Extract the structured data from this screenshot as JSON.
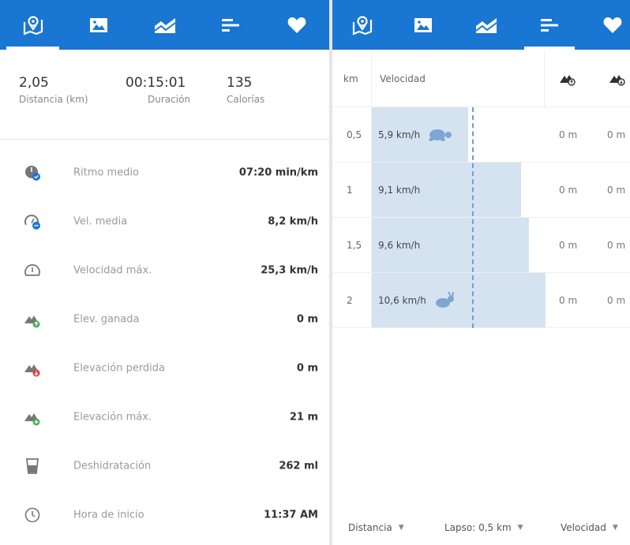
{
  "left": {
    "summary": [
      {
        "value": "2,05",
        "label": "Distancia (km)"
      },
      {
        "value": "00:15:01",
        "label": "Duración"
      },
      {
        "value": "135",
        "label": "Calorías"
      }
    ],
    "stats": [
      {
        "icon": "pace-gauge-icon",
        "label": "Ritmo medio",
        "value": "07:20 min/km"
      },
      {
        "icon": "speedometer-avg-icon",
        "label": "Vel. media",
        "value": "8,2 km/h"
      },
      {
        "icon": "speedometer-max-icon",
        "label": "Velocidad máx.",
        "value": "25,3 km/h"
      },
      {
        "icon": "elevation-gain-icon",
        "label": "Elev. ganada",
        "value": "0 m"
      },
      {
        "icon": "elevation-loss-icon",
        "label": "Elevación perdida",
        "value": "0 m"
      },
      {
        "icon": "elevation-max-icon",
        "label": "Elevación máx.",
        "value": "21 m"
      },
      {
        "icon": "glass-icon",
        "label": "Deshidratación",
        "value": "262 ml"
      },
      {
        "icon": "clock-icon",
        "label": "Hora de inicio",
        "value": "11:37 AM"
      }
    ]
  },
  "tabs": [
    {
      "icon": "map-pin-icon"
    },
    {
      "icon": "image-icon"
    },
    {
      "icon": "chart-icon"
    },
    {
      "icon": "bars-icon"
    },
    {
      "icon": "heart-icon"
    }
  ],
  "right": {
    "headers": {
      "km": "km",
      "speed": "Velocidad"
    },
    "rows": [
      {
        "km": "0,5",
        "speed": "5,9 km/h",
        "speed_kmh": 5.9,
        "marker": "turtle-icon",
        "gain": "0 m",
        "loss": "0 m"
      },
      {
        "km": "1",
        "speed": "9,1 km/h",
        "speed_kmh": 9.1,
        "marker": "",
        "gain": "0 m",
        "loss": "0 m"
      },
      {
        "km": "1,5",
        "speed": "9,6 km/h",
        "speed_kmh": 9.6,
        "marker": "",
        "gain": "0 m",
        "loss": "0 m"
      },
      {
        "km": "2",
        "speed": "10,6 km/h",
        "speed_kmh": 10.6,
        "marker": "rabbit-icon",
        "gain": "0 m",
        "loss": "0 m"
      }
    ],
    "footer": {
      "distance": "Distancia",
      "lap": "Lapso: 0,5 km",
      "metric": "Velocidad"
    }
  },
  "colors": {
    "brand": "#1976d2",
    "bar": "#d5e3f1",
    "avg_line": "#6b9fd6",
    "gain": "#4caf50",
    "loss": "#e53935"
  }
}
